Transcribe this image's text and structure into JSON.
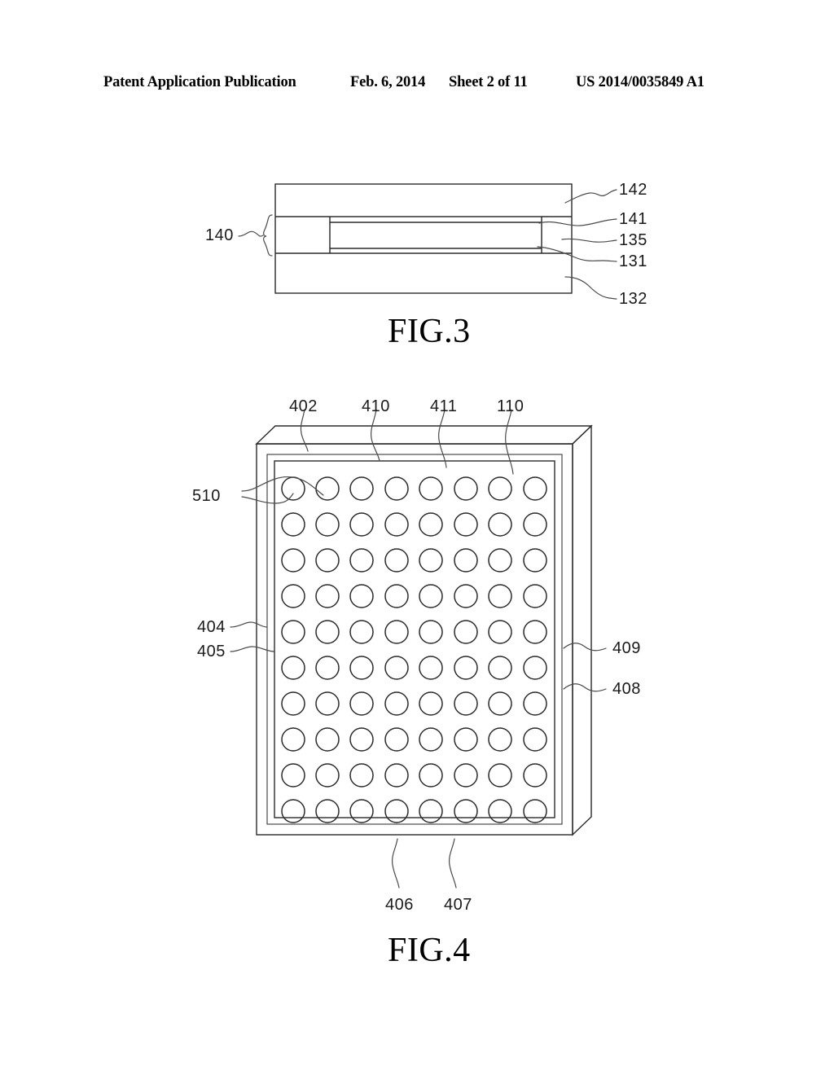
{
  "header": {
    "title": "Patent Application Publication",
    "date": "Feb. 6, 2014",
    "sheet": "Sheet 2 of 11",
    "publication_number": "US 2014/0035849 A1"
  },
  "figures": [
    {
      "id": "fig3",
      "caption": "FIG.3",
      "description": "Cross-sectional stacked-layer view",
      "labels": [
        {
          "name": "bracket-group",
          "text": "140",
          "side": "left"
        },
        {
          "name": "layer-142",
          "text": "142",
          "side": "right"
        },
        {
          "name": "layer-141",
          "text": "141",
          "side": "right"
        },
        {
          "name": "layer-135",
          "text": "135",
          "side": "right"
        },
        {
          "name": "layer-131",
          "text": "131",
          "side": "right"
        },
        {
          "name": "layer-132",
          "text": "132",
          "side": "right"
        }
      ]
    },
    {
      "id": "fig4",
      "caption": "FIG.4",
      "description": "Perspective view of panel with circular hole array",
      "grid": {
        "rows": 10,
        "columns": 8,
        "shape": "circle"
      },
      "labels": [
        {
          "name": "label-402",
          "text": "402",
          "side": "top"
        },
        {
          "name": "label-410",
          "text": "410",
          "side": "top"
        },
        {
          "name": "label-411",
          "text": "411",
          "side": "top"
        },
        {
          "name": "label-110",
          "text": "110",
          "side": "top"
        },
        {
          "name": "label-510",
          "text": "510",
          "side": "left"
        },
        {
          "name": "label-404",
          "text": "404",
          "side": "left"
        },
        {
          "name": "label-405",
          "text": "405",
          "side": "left"
        },
        {
          "name": "label-409",
          "text": "409",
          "side": "right"
        },
        {
          "name": "label-408",
          "text": "408",
          "side": "right"
        },
        {
          "name": "label-406",
          "text": "406",
          "side": "bottom"
        },
        {
          "name": "label-407",
          "text": "407",
          "side": "bottom"
        }
      ]
    }
  ],
  "colors": {
    "ink": "#2b2b2b",
    "paper": "#ffffff"
  }
}
